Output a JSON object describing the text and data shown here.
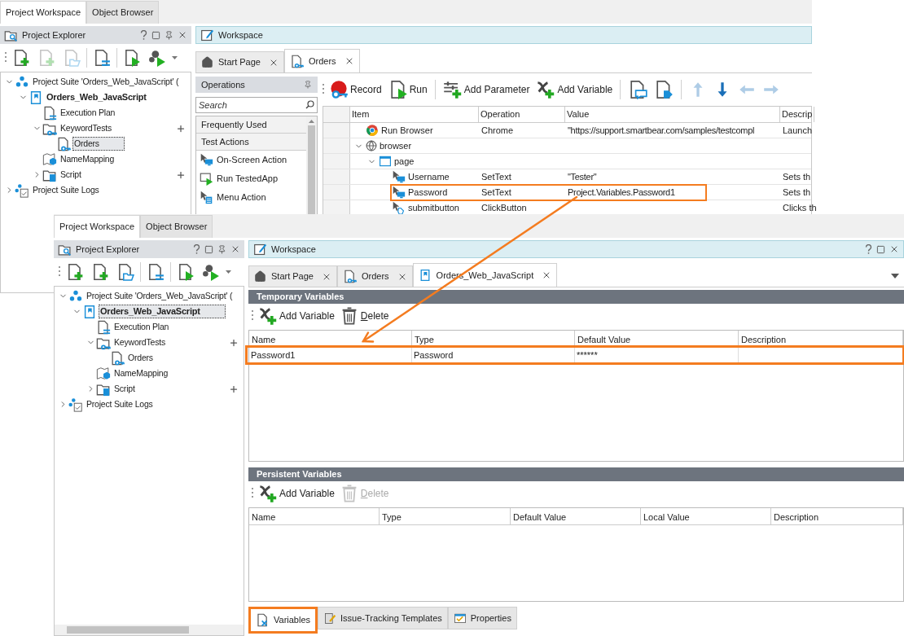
{
  "back_window": {
    "panel_tabs": [
      {
        "label": "Project Workspace",
        "selected": true
      },
      {
        "label": "Object Browser",
        "selected": false
      }
    ],
    "explorer": {
      "title": "Project Explorer",
      "toolbar": [
        [
          {
            "kind": "add",
            "disabled": false
          },
          {
            "kind": "new",
            "disabled": true
          },
          {
            "kind": "open",
            "disabled": true
          }
        ],
        [
          {
            "kind": "plan",
            "disabled": false
          }
        ],
        [
          {
            "kind": "run",
            "disabled": false
          },
          {
            "kind": "run-suite",
            "disabled": false
          }
        ]
      ],
      "tree": [
        {
          "label": "Project Suite 'Orders_Web_JavaScript' (",
          "kind": "suite",
          "expanded": true,
          "selected": false,
          "children": [
            {
              "label": "Orders_Web_JavaScript",
              "kind": "project",
              "expanded": true,
              "selected": false,
              "children": [
                {
                  "label": "Execution Plan",
                  "kind": "plan",
                  "selected": false
                },
                {
                  "label": "KeywordTests",
                  "kind": "folder",
                  "expanded": true,
                  "selected": false,
                  "children": [
                    {
                      "label": "Orders",
                      "kind": "test",
                      "selected": true
                    }
                  ]
                },
                {
                  "label": "NameMapping",
                  "kind": "mapping",
                  "selected": false
                },
                {
                  "label": "Script",
                  "kind": "script",
                  "expanded": false,
                  "selected": false
                }
              ]
            }
          ]
        },
        {
          "label": "Project Suite Logs",
          "kind": "logs",
          "expanded": false,
          "selected": false
        }
      ]
    },
    "workspace": {
      "title": "Workspace",
      "tabs": [
        {
          "label": "Start Page",
          "kind": "home",
          "selected": false
        },
        {
          "label": "Orders",
          "kind": "test",
          "selected": true
        }
      ],
      "operations": {
        "title": "Operations",
        "search_placeholder": "Search",
        "groups": [
          "Frequently Used",
          "Test Actions"
        ],
        "items": [
          {
            "label": "On-Screen Action",
            "kind": "screen"
          },
          {
            "label": "Run TestedApp",
            "kind": "run"
          },
          {
            "label": "Menu Action",
            "kind": "menu"
          }
        ]
      },
      "toolbar": [
        [
          {
            "label": "Record",
            "kind": "record",
            "disabled": false
          },
          {
            "label": "Run",
            "kind": "run",
            "disabled": false
          }
        ],
        [
          {
            "label": "Add Parameter",
            "kind": "parameter",
            "disabled": false
          },
          {
            "label": "Add Variable",
            "kind": "variable",
            "disabled": false
          }
        ],
        [
          {
            "kind": "comment",
            "disabled": false
          },
          {
            "kind": "tag",
            "disabled": false
          }
        ],
        [
          {
            "kind": "up",
            "disabled": true
          },
          {
            "kind": "down",
            "disabled": false
          },
          {
            "kind": "left",
            "disabled": true
          },
          {
            "kind": "right",
            "disabled": true
          }
        ]
      ],
      "columns": [
        "Item",
        "Operation",
        "Value",
        "Descrip"
      ],
      "rows": [
        {
          "item": "Run Browser",
          "kind": "browser-run",
          "operation": "Chrome",
          "value": "\"https://support.smartbear.com/samples/testcompl",
          "description": "Launch",
          "highlighted": false
        },
        {
          "item": "browser",
          "kind": "browser",
          "expanded": true,
          "highlighted": false,
          "children": [
            {
              "item": "page",
              "kind": "page",
              "expanded": true,
              "highlighted": false,
              "children": [
                {
                  "item": "Username",
                  "kind": "action",
                  "operation": "SetText",
                  "value": "\"Tester\"",
                  "description": "Sets th",
                  "highlighted": false
                },
                {
                  "item": "Password",
                  "kind": "action",
                  "operation": "SetText",
                  "value": "Project.Variables.Password1",
                  "description": "Sets th",
                  "highlighted": true
                },
                {
                  "item": "submitbutton",
                  "kind": "click",
                  "operation": "ClickButton",
                  "description": "Clicks th",
                  "highlighted": false
                }
              ]
            }
          ]
        }
      ]
    }
  },
  "front_window": {
    "panel_tabs": [
      {
        "label": "Project Workspace",
        "selected": true
      },
      {
        "label": "Object Browser",
        "selected": false
      }
    ],
    "explorer": {
      "title": "Project Explorer",
      "toolbar": [
        [
          {
            "kind": "add",
            "disabled": false
          },
          {
            "kind": "new",
            "disabled": false
          },
          {
            "kind": "open",
            "disabled": false
          }
        ],
        [
          {
            "kind": "plan",
            "disabled": false
          }
        ],
        [
          {
            "kind": "run",
            "disabled": false
          },
          {
            "kind": "run-suite",
            "disabled": false
          }
        ]
      ],
      "tree": [
        {
          "label": "Project Suite 'Orders_Web_JavaScript' (",
          "kind": "suite",
          "expanded": true,
          "selected": false,
          "children": [
            {
              "label": "Orders_Web_JavaScript",
              "kind": "project",
              "expanded": true,
              "selected": true,
              "children": [
                {
                  "label": "Execution Plan",
                  "kind": "plan",
                  "selected": false
                },
                {
                  "label": "KeywordTests",
                  "kind": "folder",
                  "expanded": true,
                  "selected": false,
                  "children": [
                    {
                      "label": "Orders",
                      "kind": "test",
                      "selected": false
                    }
                  ]
                },
                {
                  "label": "NameMapping",
                  "kind": "mapping",
                  "selected": false
                },
                {
                  "label": "Script",
                  "kind": "script",
                  "expanded": false,
                  "selected": false
                }
              ]
            }
          ]
        },
        {
          "label": "Project Suite Logs",
          "kind": "logs",
          "expanded": false,
          "selected": false
        }
      ]
    },
    "workspace": {
      "title": "Workspace",
      "tabs": [
        {
          "label": "Start Page",
          "kind": "home",
          "selected": false
        },
        {
          "label": "Orders",
          "kind": "test",
          "selected": false
        },
        {
          "label": "Orders_Web_JavaScript",
          "kind": "project",
          "selected": true
        }
      ],
      "sections": [
        {
          "title": "Temporary Variables",
          "toolbar": [
            {
              "label": "Add Variable",
              "kind": "add",
              "disabled": false
            },
            {
              "label": "Delete",
              "kind": "delete",
              "disabled": false
            }
          ],
          "columns": [
            "Name",
            "Type",
            "Default Value",
            "Description"
          ],
          "rows": [
            {
              "cells": [
                "Password1",
                "Password",
                "******"
              ],
              "highlighted": true
            }
          ]
        },
        {
          "title": "Persistent Variables",
          "toolbar": [
            {
              "label": "Add Variable",
              "kind": "add",
              "disabled": false
            },
            {
              "label": "Delete",
              "kind": "delete",
              "disabled": true
            }
          ],
          "columns": [
            "Name",
            "Type",
            "Default Value",
            "Local Value",
            "Description"
          ]
        }
      ],
      "bottom_tabs": [
        {
          "label": "Variables",
          "kind": "variables",
          "selected": true,
          "highlighted": true
        },
        {
          "label": "Issue-Tracking Templates",
          "kind": "issues",
          "selected": false,
          "highlighted": false
        },
        {
          "label": "Properties",
          "kind": "properties",
          "selected": false,
          "highlighted": false
        }
      ]
    }
  }
}
